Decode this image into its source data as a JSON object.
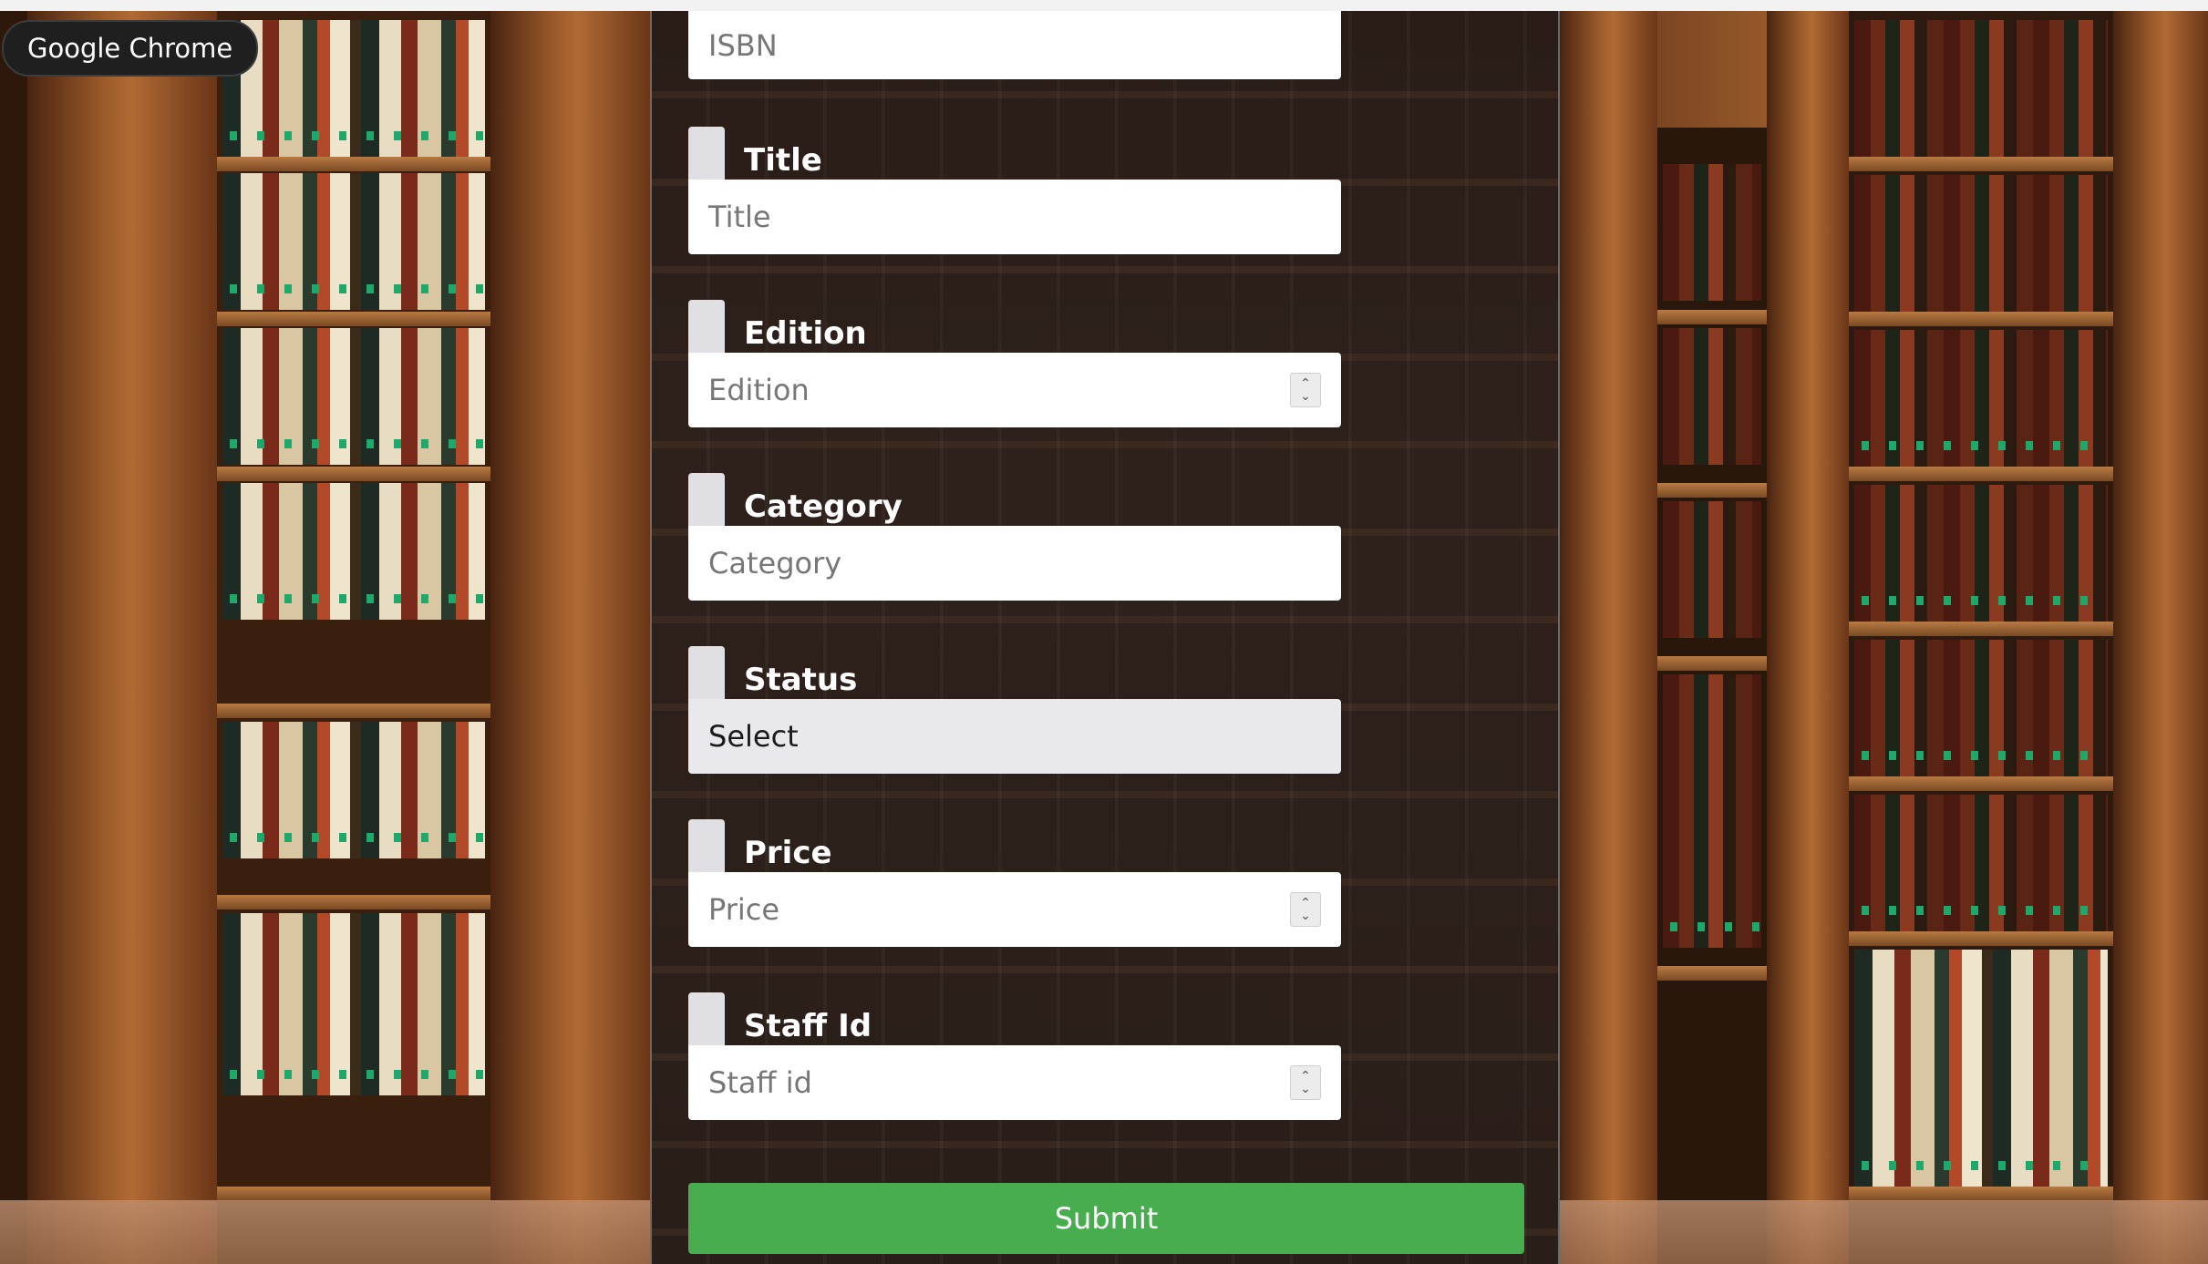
{
  "tooltip": {
    "text": "Google Chrome"
  },
  "form": {
    "fields": [
      {
        "label": "",
        "placeholder": "ISBN",
        "type": "text"
      },
      {
        "label": "Title",
        "placeholder": "Title",
        "type": "text"
      },
      {
        "label": "Edition",
        "placeholder": "Edition",
        "type": "number"
      },
      {
        "label": "Category",
        "placeholder": "Category",
        "type": "text"
      },
      {
        "label": "Status",
        "value": "Select",
        "type": "select"
      },
      {
        "label": "Price",
        "placeholder": "Price",
        "type": "number"
      },
      {
        "label": "Staff Id",
        "placeholder": "Staff id",
        "type": "number"
      }
    ],
    "submit_label": "Submit"
  },
  "colors": {
    "submit": "#47ad4e",
    "panel": "#2a1d17",
    "label": "#ffffff"
  }
}
